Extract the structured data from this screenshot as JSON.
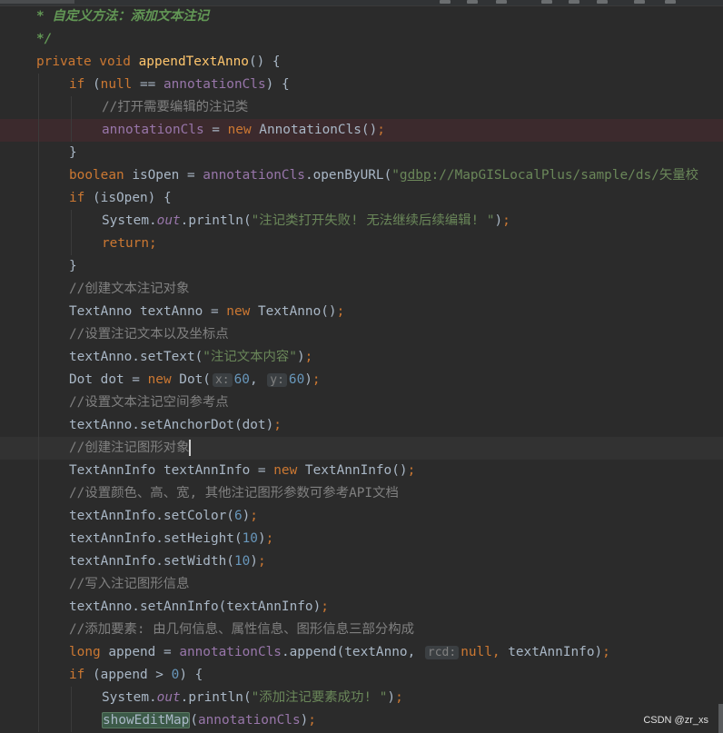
{
  "toolbar": {
    "icons": [
      "toolbar-icon-1",
      "toolbar-icon-2",
      "toolbar-icon-3",
      "toolbar-icon-4",
      "toolbar-icon-5",
      "toolbar-icon-6",
      "toolbar-icon-7",
      "toolbar-icon-8"
    ]
  },
  "editor": {
    "language": "Java",
    "lines": [
      {
        "indent": 1,
        "tokens": [
          [
            "doc",
            "* 自定义方法：添加文本注记"
          ]
        ]
      },
      {
        "indent": 1,
        "tokens": [
          [
            "doc",
            "*/"
          ]
        ]
      },
      {
        "indent": 1,
        "tokens": [
          [
            "kw",
            "private void "
          ],
          [
            "fn",
            "appendTextAnno"
          ],
          [
            "p",
            "() {"
          ]
        ]
      },
      {
        "indent": 2,
        "tokens": [
          [
            "kw",
            "if "
          ],
          [
            "p",
            "("
          ],
          [
            "kw",
            "null"
          ],
          [
            "p",
            " == "
          ],
          [
            "fld",
            "annotationCls"
          ],
          [
            "p",
            ") {"
          ]
        ]
      },
      {
        "indent": 3,
        "tokens": [
          [
            "cmt",
            "//打开需要编辑的注记类"
          ]
        ]
      },
      {
        "indent": 3,
        "err": true,
        "tokens": [
          [
            "fld",
            "annotationCls"
          ],
          [
            "p",
            " = "
          ],
          [
            "kw",
            "new "
          ],
          [
            "p",
            "AnnotationCls()"
          ],
          [
            "kw",
            ";"
          ]
        ]
      },
      {
        "indent": 2,
        "tokens": [
          [
            "p",
            "}"
          ]
        ]
      },
      {
        "indent": 2,
        "tokens": [
          [
            "kw",
            "boolean "
          ],
          [
            "p",
            "isOpen = "
          ],
          [
            "fld",
            "annotationCls"
          ],
          [
            "p",
            ".openByURL("
          ],
          [
            "str",
            "\""
          ],
          [
            "strul",
            "gdbp"
          ],
          [
            "str",
            "://MapGISLocalPlus/sample/ds/矢量校"
          ]
        ]
      },
      {
        "indent": 2,
        "tokens": [
          [
            "kw",
            "if "
          ],
          [
            "p",
            "(isOpen) {"
          ]
        ]
      },
      {
        "indent": 3,
        "tokens": [
          [
            "p",
            "System."
          ],
          [
            "sta",
            "out"
          ],
          [
            "p",
            ".println("
          ],
          [
            "str",
            "\"注记类打开失败! 无法继续后续编辑! \""
          ],
          [
            "p",
            ")"
          ],
          [
            "kw",
            ";"
          ]
        ]
      },
      {
        "indent": 3,
        "tokens": [
          [
            "kw",
            "return;"
          ]
        ]
      },
      {
        "indent": 2,
        "tokens": [
          [
            "p",
            "}"
          ]
        ]
      },
      {
        "indent": 2,
        "tokens": [
          [
            "cmt",
            "//创建文本注记对象"
          ]
        ]
      },
      {
        "indent": 2,
        "tokens": [
          [
            "p",
            "TextAnno textAnno = "
          ],
          [
            "kw",
            "new "
          ],
          [
            "p",
            "TextAnno()"
          ],
          [
            "kw",
            ";"
          ]
        ]
      },
      {
        "indent": 2,
        "tokens": [
          [
            "cmt",
            "//设置注记文本以及坐标点"
          ]
        ]
      },
      {
        "indent": 2,
        "tokens": [
          [
            "p",
            "textAnno.setText("
          ],
          [
            "str",
            "\"注记文本内容\""
          ],
          [
            "p",
            ")"
          ],
          [
            "kw",
            ";"
          ]
        ]
      },
      {
        "indent": 2,
        "tokens": [
          [
            "p",
            "Dot dot = "
          ],
          [
            "kw",
            "new "
          ],
          [
            "p",
            "Dot("
          ],
          [
            "hint",
            "x:"
          ],
          [
            "num",
            "60"
          ],
          [
            "p",
            ", "
          ],
          [
            "hint",
            "y:"
          ],
          [
            "num",
            "60"
          ],
          [
            "p",
            ")"
          ],
          [
            "kw",
            ";"
          ]
        ]
      },
      {
        "indent": 2,
        "tokens": [
          [
            "cmt",
            "//设置文本注记空间参考点"
          ]
        ]
      },
      {
        "indent": 2,
        "tokens": [
          [
            "p",
            "textAnno.setAnchorDot(dot)"
          ],
          [
            "kw",
            ";"
          ]
        ]
      },
      {
        "indent": 2,
        "cur": true,
        "tokens": [
          [
            "cmt",
            "//创建注记图形对象"
          ],
          [
            "caret",
            ""
          ]
        ]
      },
      {
        "indent": 2,
        "tokens": [
          [
            "p",
            "TextAnnInfo textAnnInfo = "
          ],
          [
            "kw",
            "new "
          ],
          [
            "p",
            "TextAnnInfo()"
          ],
          [
            "kw",
            ";"
          ]
        ]
      },
      {
        "indent": 2,
        "tokens": [
          [
            "cmt",
            "//设置颜色、高、宽, 其他注记图形参数可参考API文档"
          ]
        ]
      },
      {
        "indent": 2,
        "tokens": [
          [
            "p",
            "textAnnInfo.setColor("
          ],
          [
            "num",
            "6"
          ],
          [
            "p",
            ")"
          ],
          [
            "kw",
            ";"
          ]
        ]
      },
      {
        "indent": 2,
        "tokens": [
          [
            "p",
            "textAnnInfo.setHeight("
          ],
          [
            "num",
            "10"
          ],
          [
            "p",
            ")"
          ],
          [
            "kw",
            ";"
          ]
        ]
      },
      {
        "indent": 2,
        "tokens": [
          [
            "p",
            "textAnnInfo.setWidth("
          ],
          [
            "num",
            "10"
          ],
          [
            "p",
            ")"
          ],
          [
            "kw",
            ";"
          ]
        ]
      },
      {
        "indent": 2,
        "tokens": [
          [
            "cmt",
            "//写入注记图形信息"
          ]
        ]
      },
      {
        "indent": 2,
        "tokens": [
          [
            "p",
            "textAnno.setAnnInfo(textAnnInfo)"
          ],
          [
            "kw",
            ";"
          ]
        ]
      },
      {
        "indent": 2,
        "tokens": [
          [
            "cmt",
            "//添加要素: 由几何信息、属性信息、图形信息三部分构成"
          ]
        ]
      },
      {
        "indent": 2,
        "tokens": [
          [
            "kw",
            "long "
          ],
          [
            "p",
            "append = "
          ],
          [
            "fld",
            "annotationCls"
          ],
          [
            "p",
            ".append(textAnno, "
          ],
          [
            "hint",
            "rcd:"
          ],
          [
            "kw",
            "null"
          ],
          [
            "kw",
            ", "
          ],
          [
            "p",
            "textAnnInfo)"
          ],
          [
            "kw",
            ";"
          ]
        ]
      },
      {
        "indent": 2,
        "tokens": [
          [
            "kw",
            "if "
          ],
          [
            "p",
            "(append > "
          ],
          [
            "num",
            "0"
          ],
          [
            "p",
            ") {"
          ]
        ]
      },
      {
        "indent": 3,
        "tokens": [
          [
            "p",
            "System."
          ],
          [
            "sta",
            "out"
          ],
          [
            "p",
            ".println("
          ],
          [
            "str",
            "\"添加注记要素成功! \""
          ],
          [
            "p",
            ")"
          ],
          [
            "kw",
            ";"
          ]
        ]
      },
      {
        "indent": 3,
        "tokens": [
          [
            "hl",
            "showEditMap"
          ],
          [
            "p",
            "("
          ],
          [
            "fld",
            "annotationCls"
          ],
          [
            "p",
            ")"
          ],
          [
            "kw",
            ";"
          ]
        ]
      }
    ]
  },
  "watermark": "CSDN @zr_xs"
}
